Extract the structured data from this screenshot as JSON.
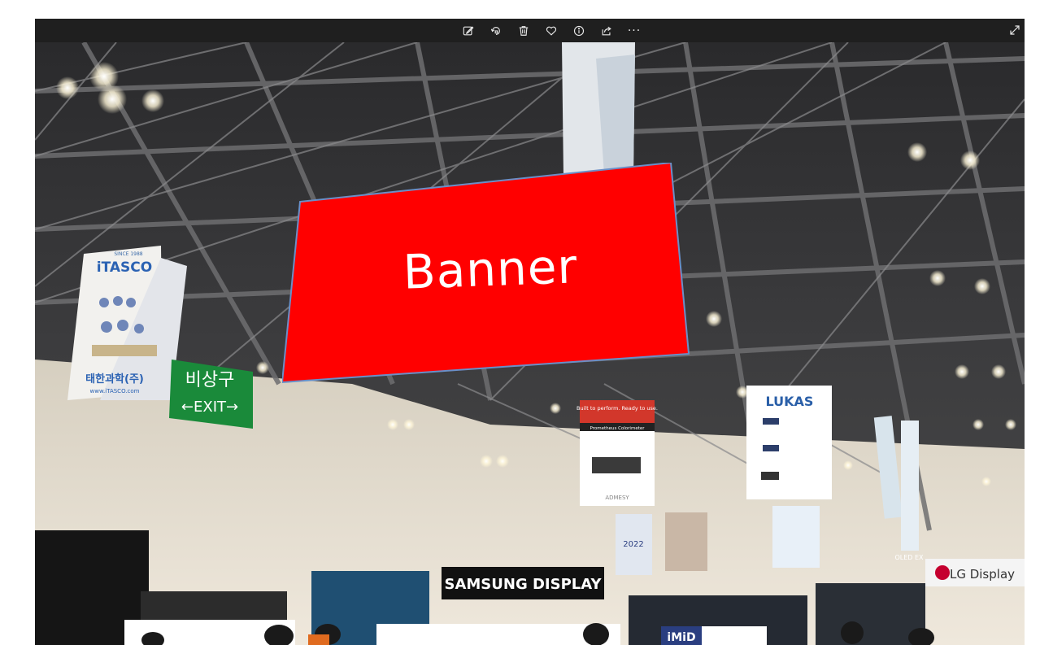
{
  "toolbar": {
    "buttons": [
      {
        "name": "edit-icon"
      },
      {
        "name": "rotate-icon"
      },
      {
        "name": "delete-icon"
      },
      {
        "name": "favorite-icon"
      },
      {
        "name": "info-icon"
      },
      {
        "name": "share-icon"
      }
    ],
    "more_label": "···",
    "expand_icon": "expand-icon"
  },
  "photo": {
    "banner_text": "Banner",
    "banner_color": "#ff0000",
    "signs": {
      "itasco_brand": "iTASCO",
      "itasco_since": "SINCE 1988",
      "itasco_korean": "태한과학(주)",
      "itasco_url": "www.iTASCO.com",
      "exit_korean": "비상구",
      "exit_english": "←EXIT→",
      "lukas_brand": "LUKAS",
      "admesy_headline": "Built to perform. Ready to use.",
      "admesy_product": "Prometheus Colorimeter",
      "admesy_brand": "ADMESY",
      "imid_label": "iMiD",
      "imid_year": "2022",
      "samsung_display": "SAMSUNG DISPLAY",
      "lg_display": "LG Display",
      "oled_ex": "OLED EX"
    }
  }
}
